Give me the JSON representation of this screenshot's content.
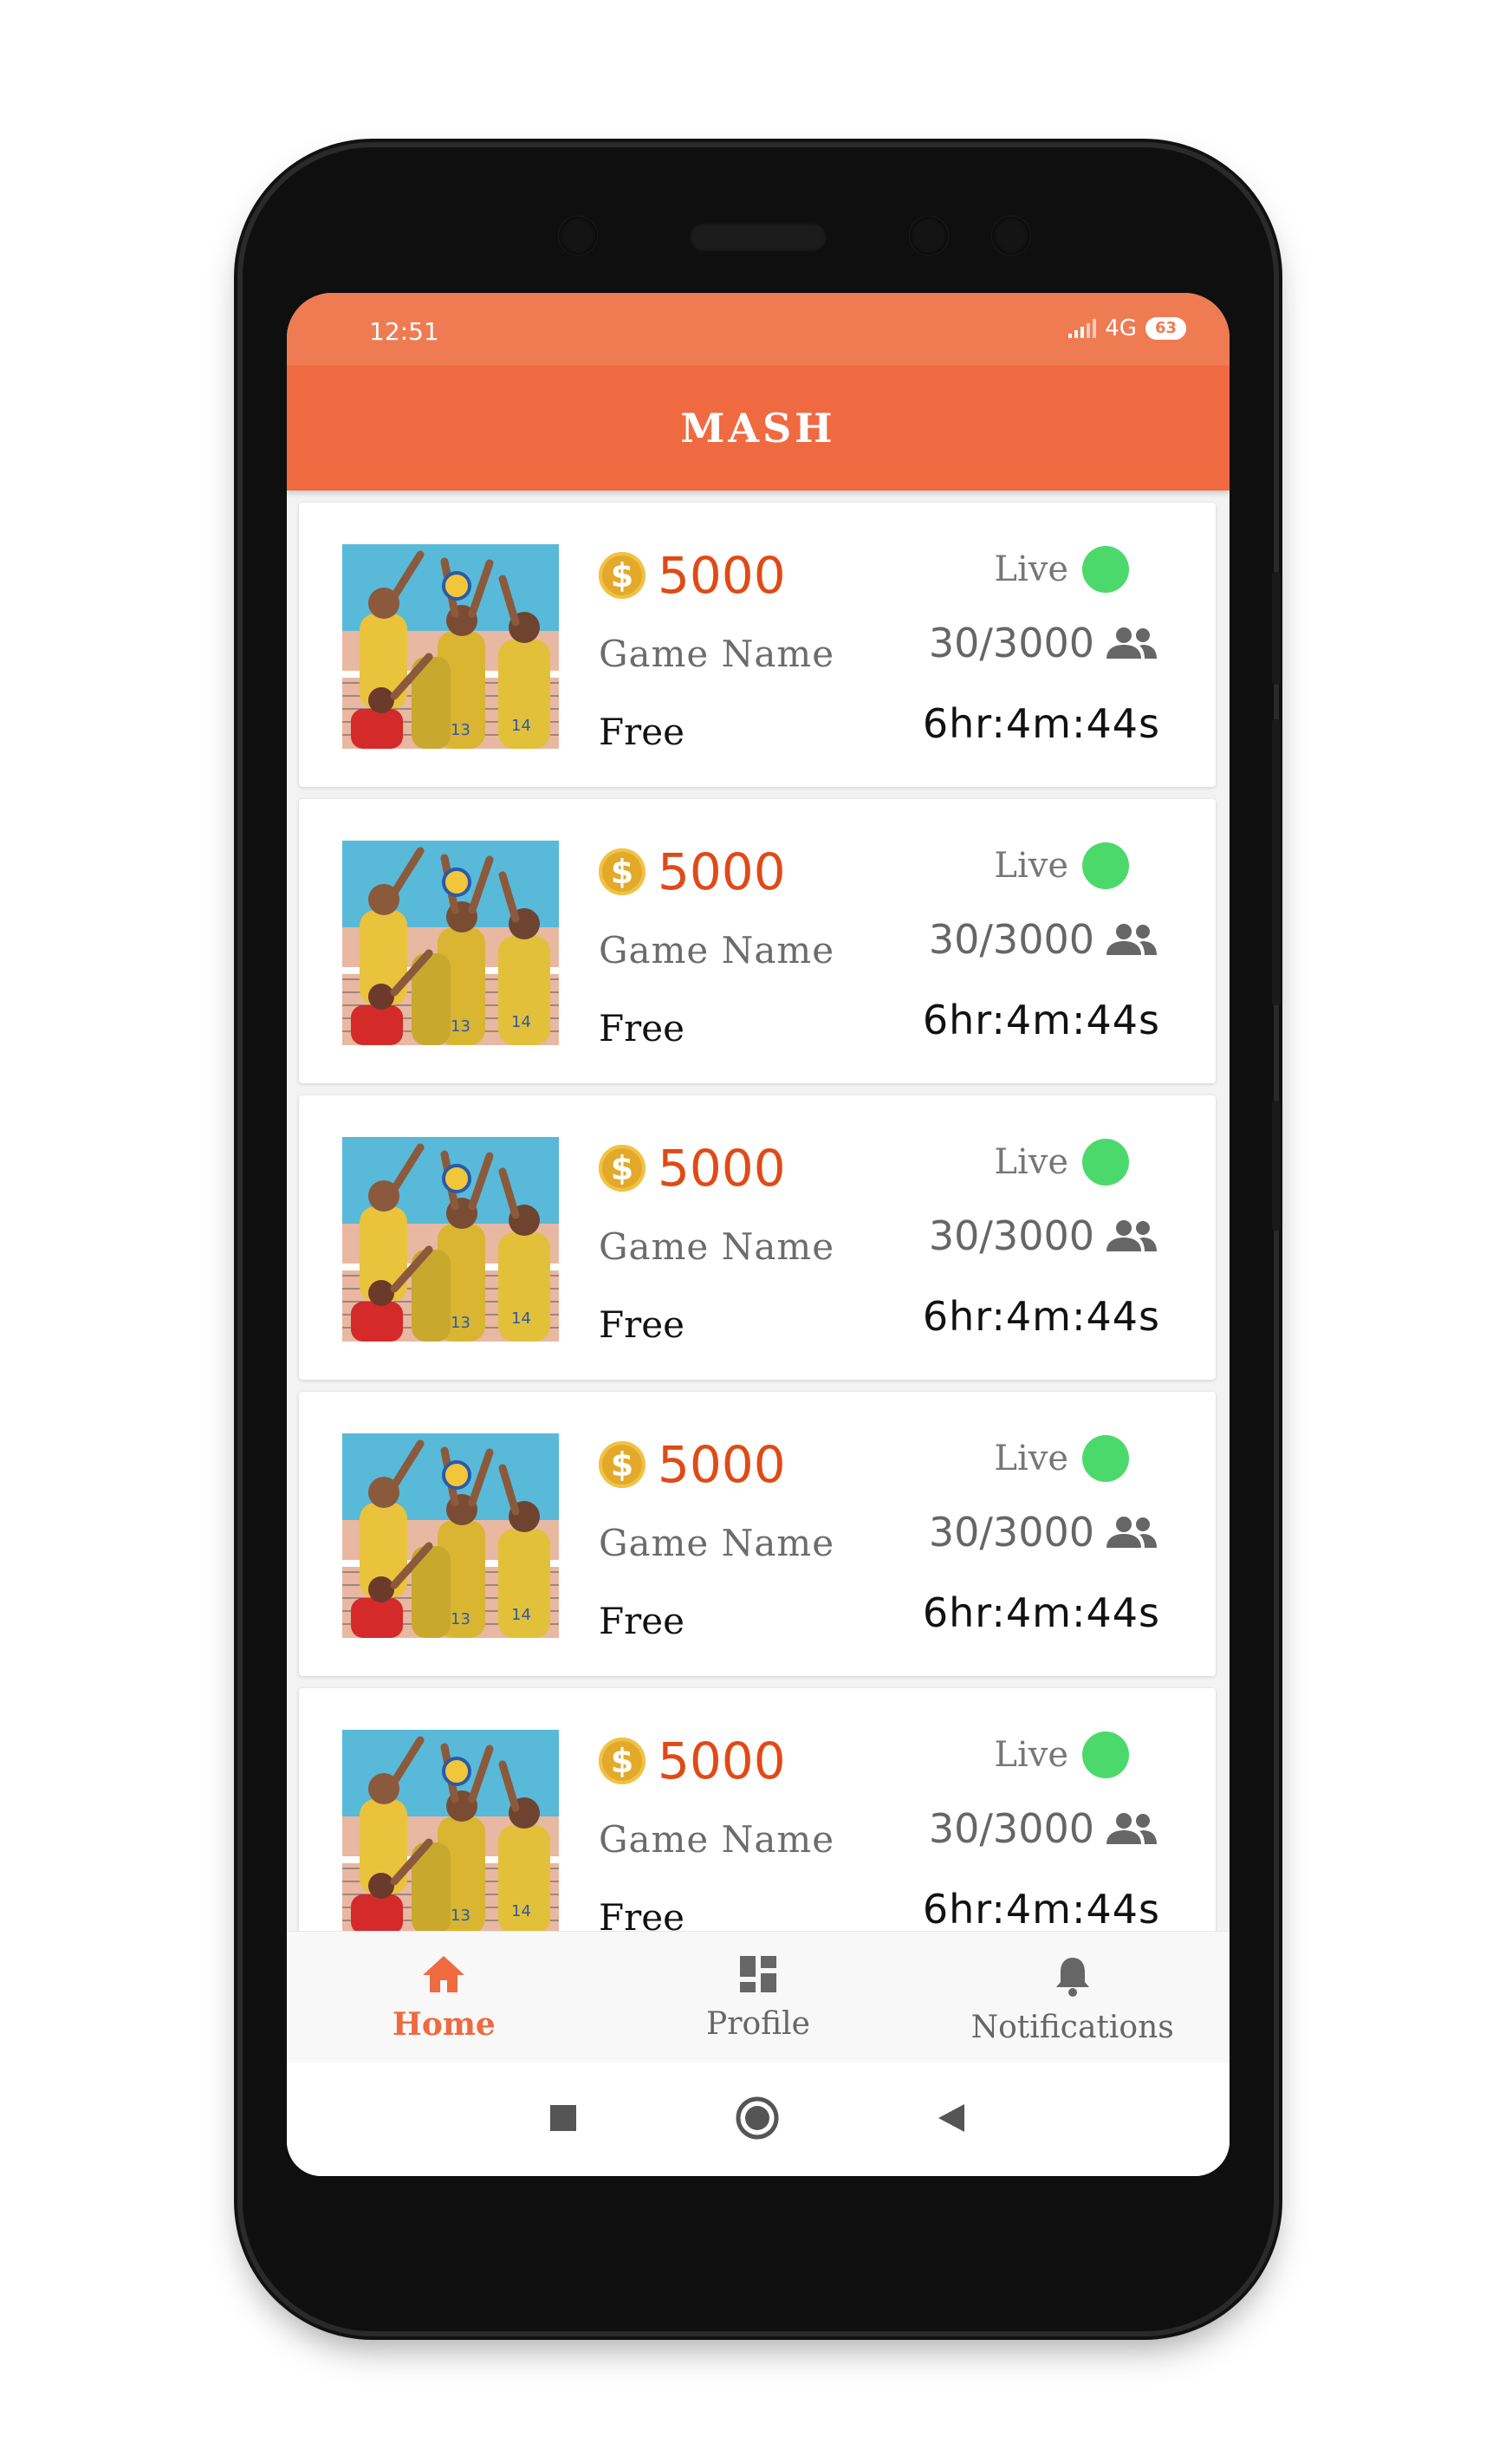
{
  "status_bar": {
    "time": "12:51",
    "network": "4G",
    "battery": "63"
  },
  "app_bar": {
    "title": "MASH"
  },
  "games": [
    {
      "amount": "5000",
      "name": "Game Name",
      "price": "Free",
      "status": "Live",
      "players": "30/3000",
      "timer": "6hr:4m:44s"
    },
    {
      "amount": "5000",
      "name": "Game Name",
      "price": "Free",
      "status": "Live",
      "players": "30/3000",
      "timer": "6hr:4m:44s"
    },
    {
      "amount": "5000",
      "name": "Game Name",
      "price": "Free",
      "status": "Live",
      "players": "30/3000",
      "timer": "6hr:4m:44s"
    },
    {
      "amount": "5000",
      "name": "Game Name",
      "price": "Free",
      "status": "Live",
      "players": "30/3000",
      "timer": "6hr:4m:44s"
    },
    {
      "amount": "5000",
      "name": "Game Name",
      "price": "Free",
      "status": "Live",
      "players": "30/3000",
      "timer": "6hr:4m:44s"
    }
  ],
  "bottom_nav": [
    {
      "label": "Home",
      "icon": "home-icon",
      "active": true
    },
    {
      "label": "Profile",
      "icon": "dashboard-icon",
      "active": false
    },
    {
      "label": "Notifications",
      "icon": "bell-icon",
      "active": false
    }
  ],
  "system_nav": [
    "square-recents-icon",
    "circle-home-icon",
    "triangle-back-icon"
  ],
  "colors": {
    "accent": "#ef6a40",
    "status_bar": "#ef7b53",
    "amount": "#e04a16",
    "coin": "#e2a92a",
    "live": "#4cd96b"
  }
}
